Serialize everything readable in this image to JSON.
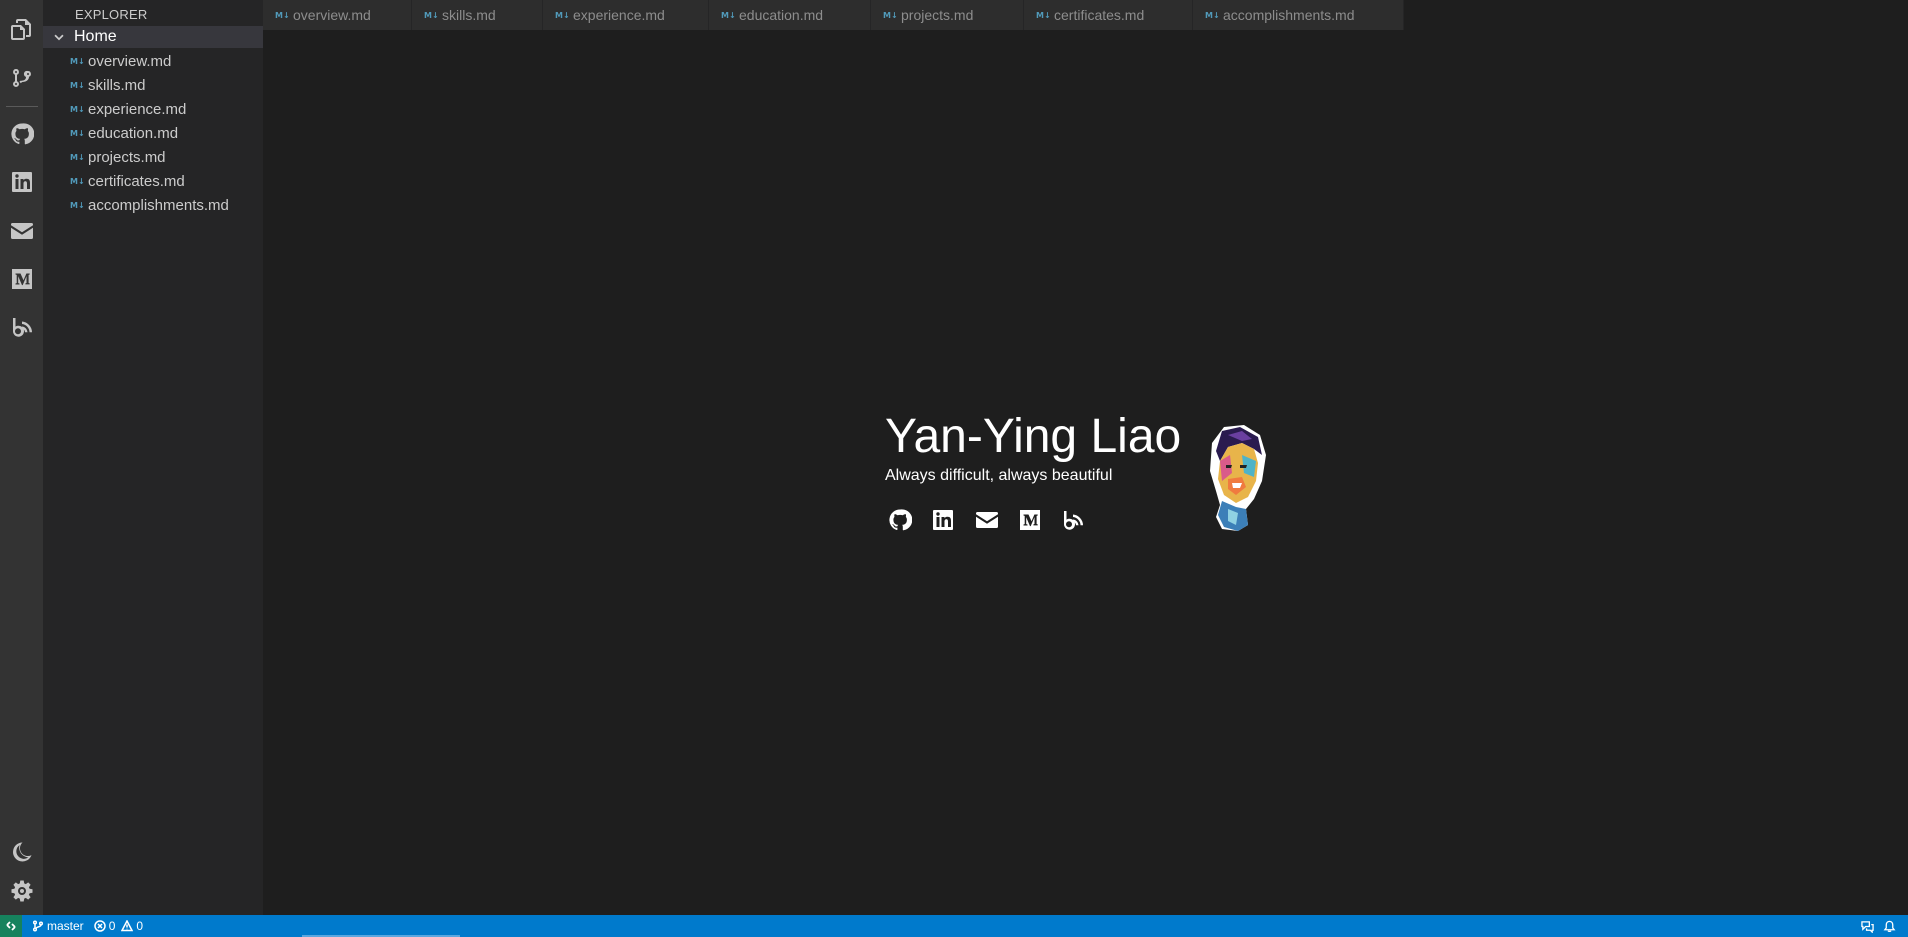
{
  "activity_bar": {
    "items": [
      "explorer-icon",
      "source-control-icon",
      "github-icon",
      "linkedin-icon",
      "email-icon",
      "medium-icon",
      "blog-icon"
    ],
    "bottom": [
      "theme-moon-icon",
      "settings-gear-icon"
    ]
  },
  "explorer": {
    "title": "EXPLORER",
    "folder": "Home",
    "files": [
      "overview.md",
      "skills.md",
      "experience.md",
      "education.md",
      "projects.md",
      "certificates.md",
      "accomplishments.md"
    ]
  },
  "tabs": [
    "overview.md",
    "skills.md",
    "experience.md",
    "education.md",
    "projects.md",
    "certificates.md",
    "accomplishments.md"
  ],
  "file_icon": "M↓",
  "hero": {
    "name": "Yan-Ying Liao",
    "tagline": "Always difficult, always beautiful",
    "links": [
      "github-icon",
      "linkedin-icon",
      "email-icon",
      "medium-icon",
      "blog-icon"
    ]
  },
  "status_bar": {
    "branch": "master",
    "errors": "0",
    "warnings": "0"
  },
  "colors": {
    "accent": "#007acc",
    "remote": "#16825d",
    "editor_bg": "#1e1e1e",
    "sidebar_bg": "#252526",
    "activity_bg": "#333333"
  }
}
